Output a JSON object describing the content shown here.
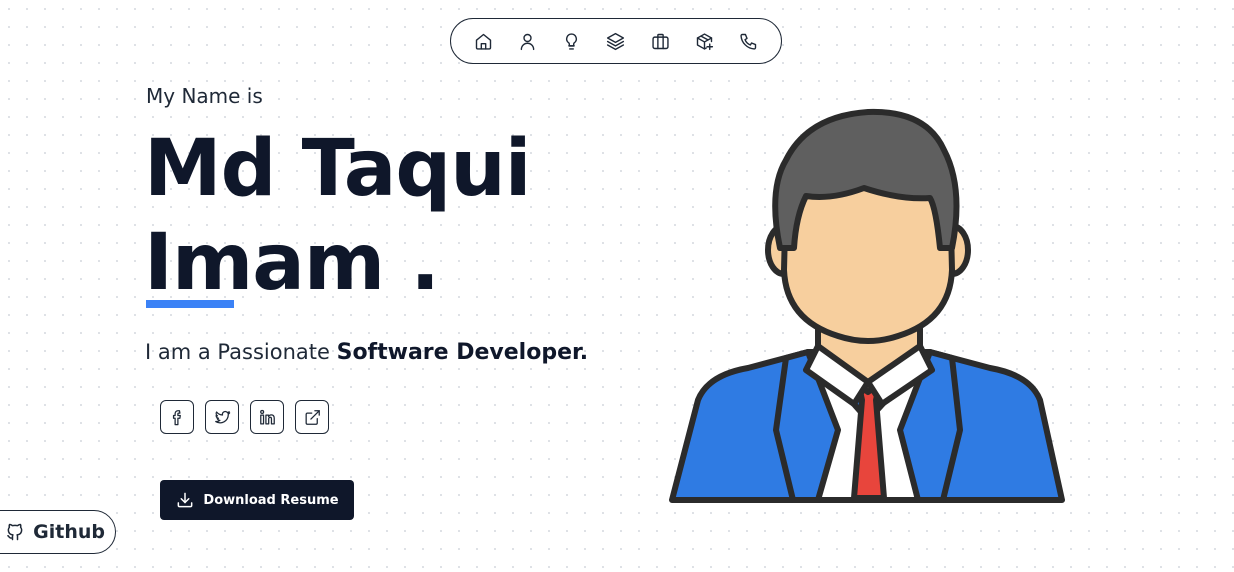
{
  "nav": {
    "items": [
      {
        "icon": "home-icon"
      },
      {
        "icon": "user-icon"
      },
      {
        "icon": "lightbulb-icon"
      },
      {
        "icon": "layers-icon"
      },
      {
        "icon": "briefcase-icon"
      },
      {
        "icon": "package-plus-icon"
      },
      {
        "icon": "phone-icon"
      }
    ]
  },
  "hero": {
    "intro": "My Name is",
    "name_line1": "Md Taqui",
    "name_line2": "Imam .",
    "tagline_prefix": "I am a Passionate",
    "tagline_role": "Software Developer."
  },
  "socials": [
    {
      "icon": "facebook-icon"
    },
    {
      "icon": "twitter-icon"
    },
    {
      "icon": "linkedin-icon"
    },
    {
      "icon": "external-link-icon"
    }
  ],
  "download": {
    "label": "Download Resume",
    "icon": "download-icon"
  },
  "github": {
    "label": "Github",
    "icon": "github-icon"
  },
  "colors": {
    "accent": "#3b82f6",
    "dark": "#0f172a",
    "suit": "#2f7be3",
    "tie": "#e8453c",
    "skin": "#f7cf9e",
    "hair": "#5f5f5f"
  }
}
